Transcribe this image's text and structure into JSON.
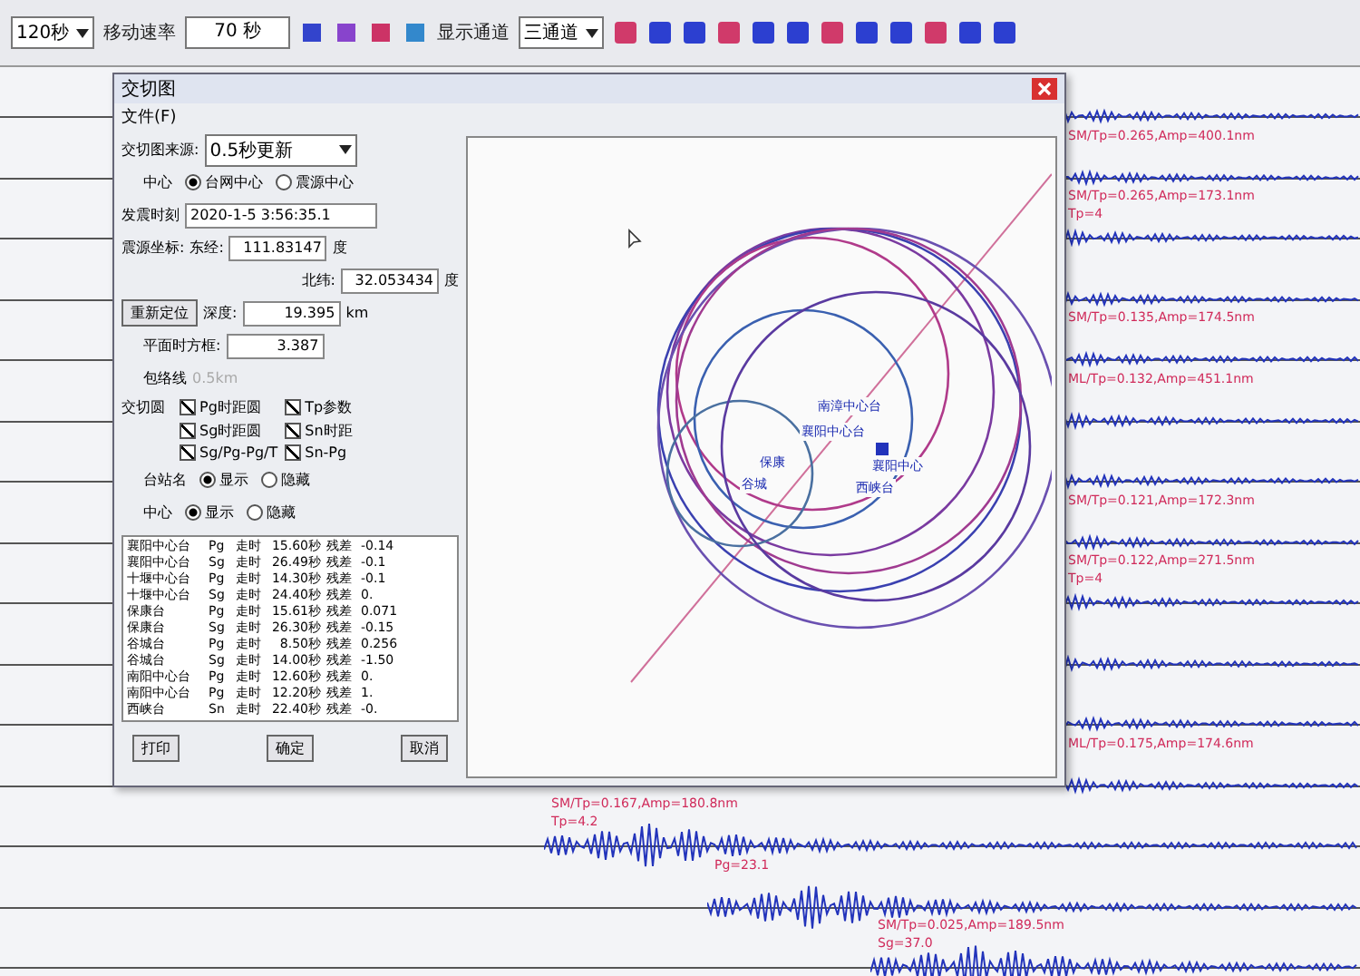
{
  "toolbar": {
    "duration": "120秒",
    "speed_label": "移动速率",
    "seconds": "70 秒",
    "channel_label": "显示通道",
    "channel": "三通道"
  },
  "dialog": {
    "title": "交切图",
    "menu": [
      "文件(F)"
    ],
    "source_label": "交切图来源:",
    "source": "0.5秒更新",
    "center_label": "中心",
    "center_options": [
      {
        "label": "台网中心",
        "selected": true
      },
      {
        "label": "震源中心",
        "selected": false
      }
    ],
    "time_label": "发震时刻",
    "time": "2020-1-5 3:56:35.1",
    "coord_label": "震源坐标:",
    "lon_label": "东经:",
    "lon": "111.83147",
    "lon_unit": "度",
    "lat_label": "北纬:",
    "lat": "32.053434",
    "lat_unit": "度",
    "relocate": "重新定位",
    "depth_label": "深度:",
    "depth": "19.395",
    "depth_unit": "km",
    "error_label": "平面时方框:",
    "error": "3.387",
    "envelope_label": "包络线",
    "envelope": "0.5km",
    "circles_label": "交切圆",
    "circles": [
      {
        "label": "Pg时距圆",
        "checked": true
      },
      {
        "label": "Tp参数",
        "checked": true
      },
      {
        "label": "Sg时距圆",
        "checked": true
      },
      {
        "label": "Sn时距",
        "checked": true
      },
      {
        "label": "Sg/Pg-Pg/T",
        "checked": true
      },
      {
        "label": "Sn-Pg",
        "checked": true
      }
    ],
    "station_label": "台站名",
    "station_options": [
      {
        "label": "显示",
        "selected": true
      },
      {
        "label": "隐藏",
        "selected": false
      }
    ],
    "center2_label": "中心",
    "center2_options": [
      {
        "label": "显示",
        "selected": true
      },
      {
        "label": "隐藏",
        "selected": false
      }
    ],
    "rows": [
      [
        "襄阳中心台",
        "Pg",
        "走时",
        "15.60秒",
        "残差",
        "-0.14"
      ],
      [
        "襄阳中心台",
        "Sg",
        "走时",
        "26.49秒",
        "残差",
        "-0.1"
      ],
      [
        "十堰中心台",
        "Pg",
        "走时",
        "14.30秒",
        "残差",
        "-0.1"
      ],
      [
        "十堰中心台",
        "Sg",
        "走时",
        "24.40秒",
        "残差",
        "0."
      ],
      [
        "保康台",
        "Pg",
        "走时",
        "15.61秒",
        "残差",
        "0.071"
      ],
      [
        "保康台",
        "Sg",
        "走时",
        "26.30秒",
        "残差",
        "-0.15"
      ],
      [
        "谷城台",
        "Pg",
        "走时",
        "8.50秒",
        "残差",
        "0.256"
      ],
      [
        "谷城台",
        "Sg",
        "走时",
        "14.00秒",
        "残差",
        "-1.50"
      ],
      [
        "南阳中心台",
        "Pg",
        "走时",
        "12.60秒",
        "残差",
        "0."
      ],
      [
        "南阳中心台",
        "Pg",
        "走时",
        "12.20秒",
        "残差",
        "1."
      ],
      [
        "西峡台",
        "Sn",
        "走时",
        "22.40秒",
        "残差",
        "-0."
      ]
    ],
    "buttons": [
      "打印",
      "确定",
      "取消"
    ],
    "plot_labels": [
      "南漳中心台",
      "襄阳中心台",
      "保康",
      "谷城",
      "襄阳中心",
      "西峡台"
    ]
  },
  "traces": [
    {
      "kind": "trace"
    },
    {
      "kind": "trace",
      "label": "SM/Tp=0.265,Amp=400.1nm"
    },
    {
      "kind": "trace",
      "label": "SM/Tp=0.265,Amp=173.1nm",
      "note": "Tp=4"
    },
    {
      "kind": "trace"
    },
    {
      "kind": "trace",
      "label": "SM/Tp=0.135,Amp=174.5nm"
    },
    {
      "kind": "trace",
      "label": "ML/Tp=0.132,Amp=451.1nm"
    },
    {
      "kind": "trace"
    },
    {
      "kind": "trace",
      "label": "SM/Tp=0.121,Amp=172.3nm"
    },
    {
      "kind": "trace",
      "label": "SM/Tp=0.122,Amp=271.5nm",
      "note": "Tp=4"
    },
    {
      "kind": "trace"
    },
    {
      "kind": "trace"
    },
    {
      "kind": "trace",
      "label": "ML/Tp=0.175,Amp=174.6nm"
    },
    {
      "kind": "event",
      "label": "SM/Tp=0.167,Amp=180.8nm",
      "note": "Tp=4.2"
    },
    {
      "kind": "event",
      "label": "Pg=23.1"
    },
    {
      "kind": "event",
      "label": "SM/Tp=0.025,Amp=189.5nm",
      "note": "Sg=37.0"
    }
  ]
}
